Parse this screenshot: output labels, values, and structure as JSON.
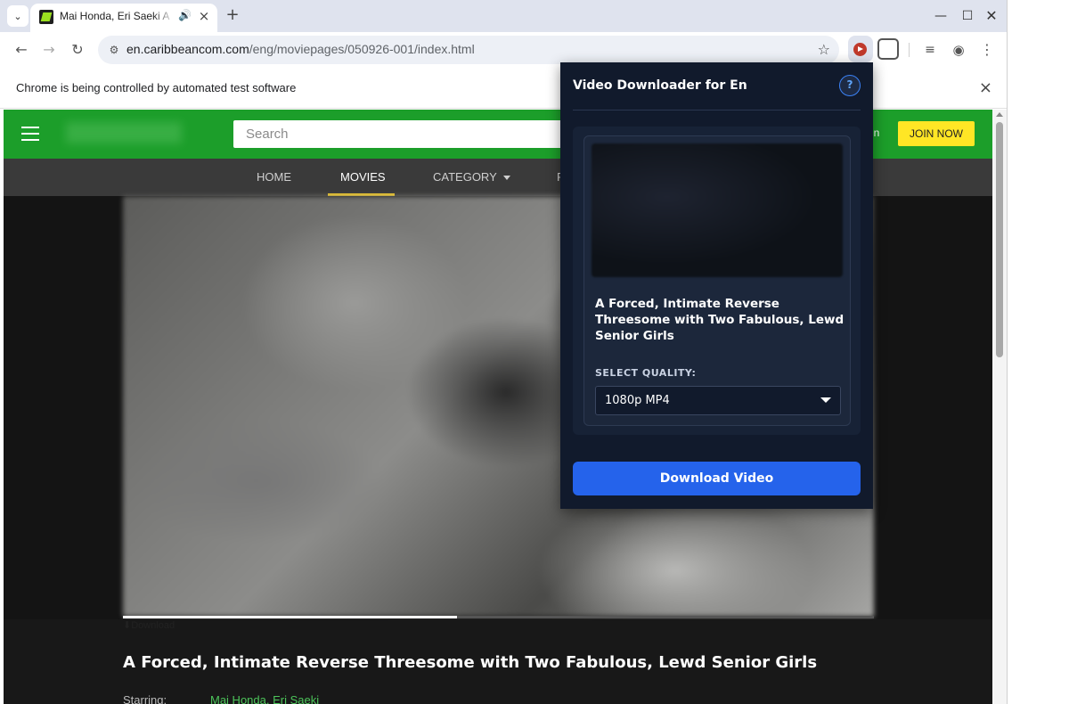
{
  "browser": {
    "tab_title": "Mai Honda, Eri Saeki A",
    "url_host": "en.caribbeancom.com",
    "url_path": "/eng/moviepages/050926-001/index.html",
    "infobar_text": "Chrome is being controlled by automated test software"
  },
  "site": {
    "search_placeholder": "Search",
    "login_fragment": "in",
    "join_label": "JOIN NOW",
    "nav": {
      "home": "HOME",
      "movies": "MOVIES",
      "category": "CATEGORY",
      "partial": "F"
    },
    "download_link": "⬇Download",
    "playback_progress": 0.445,
    "movie_title": "A Forced, Intimate Reverse Threesome with Two Fabulous, Lewd Senior Girls",
    "starring_label": "Starring:",
    "starring_value": "Mai Honda, Eri Saeki"
  },
  "popup": {
    "title": "Video Downloader for En",
    "help_label": "?",
    "video_title": "A Forced, Intimate Reverse Threesome with Two Fabulous, Lewd Senior Girls",
    "quality_label": "SELECT QUALITY:",
    "quality_selected": "1080p MP4",
    "download_label": "Download Video",
    "accent_color": "#2563eb"
  }
}
